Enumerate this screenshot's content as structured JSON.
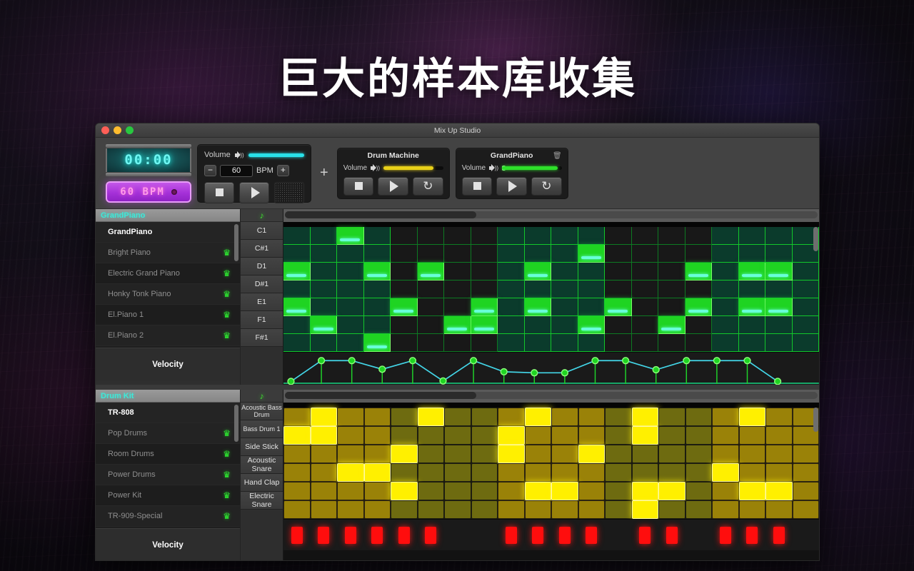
{
  "headline": "巨大的样本库收集",
  "window": {
    "title": "Mix Up Studio"
  },
  "transport": {
    "time_display": "00:00",
    "bpm_display": "60  BPM",
    "master": {
      "volume_label": "Volume",
      "volume_pct": 100,
      "minus_label": "−",
      "bpm_value": "60",
      "bpm_label": "BPM",
      "plus_label": "+",
      "stop_icon": "stop-icon",
      "play_icon": "play-icon",
      "speaker_icon": "speaker-icon"
    },
    "add_label": "+",
    "tracks": [
      {
        "name": "Drum Machine",
        "volume_label": "Volume",
        "volume_pct": 84,
        "color": "#e8d018",
        "has_trash": false,
        "buttons": [
          "stop-icon",
          "play-icon",
          "loop-icon"
        ]
      },
      {
        "name": "GrandPiano",
        "volume_label": "Volume",
        "volume_pct": 93,
        "color": "#2ee02a",
        "has_trash": true,
        "buttons": [
          "stop-icon",
          "play-icon",
          "loop-icon"
        ]
      }
    ]
  },
  "piano_section": {
    "sidebar_header": "GrandPiano",
    "velocity_label": "Velocity",
    "items": [
      {
        "label": "GrandPiano",
        "selected": true,
        "crown": false
      },
      {
        "label": "Bright Piano",
        "selected": false,
        "crown": true
      },
      {
        "label": "Electric Grand Piano",
        "selected": false,
        "crown": true
      },
      {
        "label": "Honky Tonk Piano",
        "selected": false,
        "crown": true
      },
      {
        "label": "El.Piano 1",
        "selected": false,
        "crown": true
      },
      {
        "label": "El.Piano 2",
        "selected": false,
        "crown": true
      }
    ],
    "keys": [
      "C1",
      "C#1",
      "D1",
      "D#1",
      "E1",
      "F1",
      "F#1"
    ],
    "columns": 20,
    "grid": [
      [
        0,
        0,
        1,
        0,
        0,
        0,
        0,
        0,
        0,
        0,
        0,
        0,
        0,
        0,
        0,
        0,
        0,
        0,
        0,
        0
      ],
      [
        0,
        0,
        0,
        0,
        0,
        0,
        0,
        0,
        0,
        0,
        0,
        1,
        0,
        0,
        0,
        0,
        0,
        0,
        0,
        0
      ],
      [
        1,
        0,
        0,
        1,
        0,
        1,
        0,
        0,
        0,
        1,
        0,
        0,
        0,
        0,
        0,
        1,
        0,
        1,
        1,
        0
      ],
      [
        0,
        0,
        0,
        0,
        0,
        0,
        0,
        0,
        0,
        0,
        0,
        0,
        0,
        0,
        0,
        0,
        0,
        0,
        0,
        0
      ],
      [
        1,
        0,
        0,
        0,
        1,
        0,
        0,
        1,
        0,
        1,
        0,
        0,
        1,
        0,
        0,
        1,
        0,
        1,
        1,
        0
      ],
      [
        0,
        1,
        0,
        0,
        0,
        0,
        1,
        1,
        0,
        0,
        0,
        1,
        0,
        0,
        1,
        0,
        0,
        0,
        0,
        0
      ],
      [
        0,
        0,
        0,
        1,
        0,
        0,
        0,
        0,
        0,
        0,
        0,
        0,
        0,
        0,
        0,
        0,
        0,
        0,
        0,
        0
      ]
    ],
    "velocity_points": [
      10,
      92,
      92,
      58,
      92,
      12,
      92,
      48,
      44,
      44,
      92,
      92,
      56,
      92,
      92,
      92,
      10
    ]
  },
  "drum_section": {
    "sidebar_header": "Drum Kit",
    "velocity_label": "Velocity",
    "items": [
      {
        "label": "TR-808",
        "selected": true,
        "crown": false
      },
      {
        "label": "Pop Drums",
        "selected": false,
        "crown": true
      },
      {
        "label": "Room Drums",
        "selected": false,
        "crown": true
      },
      {
        "label": "Power Drums",
        "selected": false,
        "crown": true
      },
      {
        "label": "Power Kit",
        "selected": false,
        "crown": true
      },
      {
        "label": "TR-909-Special",
        "selected": false,
        "crown": true
      }
    ],
    "rows": [
      "Acoustic Bass Drum",
      "Bass Drum 1",
      "Side Stick",
      "Acoustic Snare",
      "Hand Clap",
      "Electric Snare"
    ],
    "columns": 20,
    "grid": [
      [
        0,
        1,
        0,
        0,
        0,
        1,
        0,
        0,
        0,
        1,
        0,
        0,
        0,
        1,
        0,
        0,
        0,
        1,
        0,
        0
      ],
      [
        1,
        1,
        0,
        0,
        0,
        0,
        0,
        0,
        1,
        0,
        0,
        0,
        0,
        1,
        0,
        0,
        0,
        0,
        0,
        0
      ],
      [
        0,
        0,
        0,
        0,
        1,
        0,
        0,
        0,
        1,
        0,
        0,
        1,
        0,
        0,
        0,
        0,
        0,
        0,
        0,
        0
      ],
      [
        0,
        0,
        1,
        1,
        0,
        0,
        0,
        0,
        0,
        0,
        0,
        0,
        0,
        0,
        0,
        0,
        1,
        0,
        0,
        0
      ],
      [
        0,
        0,
        0,
        0,
        1,
        0,
        0,
        0,
        0,
        1,
        1,
        0,
        0,
        1,
        1,
        0,
        0,
        1,
        1,
        0
      ],
      [
        0,
        0,
        0,
        0,
        0,
        0,
        0,
        0,
        0,
        0,
        0,
        0,
        0,
        1,
        0,
        0,
        0,
        0,
        0,
        0
      ]
    ],
    "velocity_bars": [
      1,
      1,
      1,
      1,
      1,
      1,
      0,
      0,
      1,
      1,
      1,
      1,
      0,
      1,
      1,
      0,
      1,
      1,
      1,
      0
    ]
  },
  "icons": {
    "note": "♪",
    "crown": "♛",
    "trash": "🗑",
    "loop": "↻"
  }
}
